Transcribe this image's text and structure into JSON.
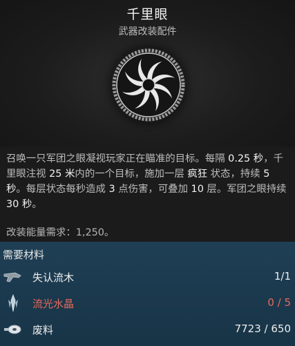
{
  "item": {
    "name": "千里眼",
    "category": "武器改装配件",
    "icon": "swirl-emblem-icon"
  },
  "description": {
    "segments": [
      {
        "text": "召唤一只军团之眼凝视玩家正在瞄准的目标。每隔 ",
        "hl": false
      },
      {
        "text": "0.25 秒",
        "hl": true
      },
      {
        "text": "，千里眼注视 ",
        "hl": false
      },
      {
        "text": "25 米",
        "hl": true
      },
      {
        "text": "内的一个目标，施加一层 ",
        "hl": false
      },
      {
        "text": "疯狂",
        "hl": true
      },
      {
        "text": " 状态，持续 ",
        "hl": false
      },
      {
        "text": "5 秒",
        "hl": true
      },
      {
        "text": "。每层状态每秒造成 ",
        "hl": false
      },
      {
        "text": "3",
        "hl": true
      },
      {
        "text": " 点伤害，可叠加 ",
        "hl": false
      },
      {
        "text": "10",
        "hl": true
      },
      {
        "text": " 层。军团之眼持续 ",
        "hl": false
      },
      {
        "text": "30 秒",
        "hl": true
      },
      {
        "text": "。",
        "hl": false
      }
    ],
    "energy_requirement": "改装能量需求：1,250。"
  },
  "materials": {
    "title": "需要材料",
    "items": [
      {
        "name": "失认流木",
        "count": "1/1",
        "icon": "driftwood-icon",
        "lacking": false
      },
      {
        "name": "流光水晶",
        "count": "0 / 5",
        "icon": "crystal-icon",
        "lacking": true
      },
      {
        "name": "废料",
        "count": "7723 / 650",
        "icon": "scrap-icon",
        "lacking": false
      }
    ]
  },
  "colors": {
    "materials_bg": "#1f3f55",
    "lacking": "#e66a5c",
    "highlight": "#f4f4f4"
  }
}
